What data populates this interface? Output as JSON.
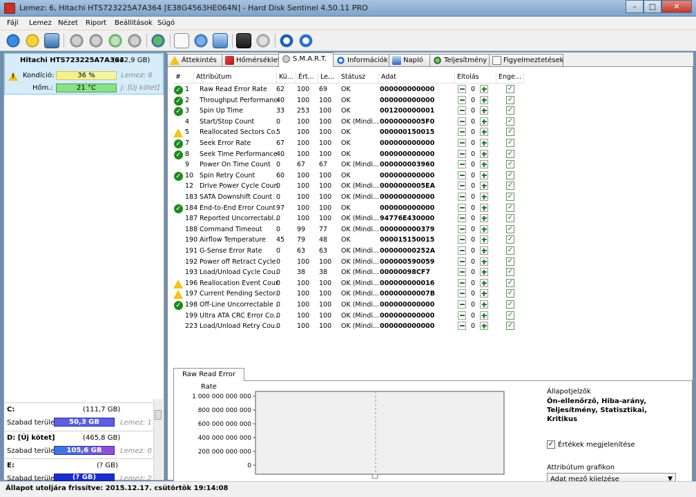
{
  "window": {
    "title": "Lemez: 6, Hitachi HTS723225A7A364 [E38G4563HE064N]  -  Hard Disk Sentinel 4.50.11 PRO",
    "min": "–",
    "max": "□",
    "close": "✕"
  },
  "menu": [
    "Fájl",
    "Lemez",
    "Nézet",
    "Riport",
    "Beállítások",
    "Súgó"
  ],
  "toolbar": [
    "refresh-icon",
    "alert-icon",
    "disk-icon",
    "fan-icon",
    "fan-icon",
    "fan-icon",
    "fan-icon",
    "globe-icon",
    "document-icon",
    "swap-icon",
    "network-icon",
    "test-icon",
    "speaker-icon",
    "help-icon",
    "info-icon"
  ],
  "left": {
    "disk_name": "Hitachi HTS723225A7A364",
    "disk_size": "(232,9 GB)",
    "cond_label": "Kondíció:",
    "cond_value": "36 %",
    "cond_pct": 36,
    "cond_disk": "Lemez: 6",
    "temp_label": "Hőm.:",
    "temp_value": "21 °C",
    "temp_pct": 100,
    "temp_vol": "J: [Új kötet]",
    "drives": [
      {
        "name": "C:",
        "size": "(111,7 GB)",
        "free_label": "Szabad terület",
        "free": "50,3 GB",
        "free_pct": 100,
        "disk": "Lemez: 1",
        "color": "#5d5fe2"
      },
      {
        "name": "D: [Új kötet]",
        "size": "(465,8 GB)",
        "free_label": "Szabad terület",
        "free": "105,6 GB",
        "free_pct": 100,
        "disk": "Lemez: 0",
        "color": "#2f7be0"
      },
      {
        "name": "E:",
        "size": "(? GB)",
        "free_label": "Szabad terület",
        "free": "(? GB)",
        "free_pct": 100,
        "disk": "Lemez: 2",
        "color": "#1a2bd0"
      }
    ]
  },
  "tabs": [
    {
      "label": "Áttekintés",
      "icon": "warning-icon"
    },
    {
      "label": "Hőmérséklet",
      "icon": "thermometer-icon"
    },
    {
      "label": "S.M.A.R.T.",
      "icon": "smart-icon"
    },
    {
      "label": "Információk",
      "icon": "info-icon"
    },
    {
      "label": "Napló",
      "icon": "log-icon"
    },
    {
      "label": "Teljesítmény",
      "icon": "performance-icon"
    },
    {
      "label": "Figyelmeztetések",
      "icon": "alerts-icon"
    }
  ],
  "smart": {
    "headers": [
      "#",
      "Attribútum",
      "Kü...",
      "Ért...",
      "Le...",
      "Státusz",
      "Adat",
      "Eltolás",
      "Enge..."
    ],
    "rows": [
      {
        "st": "ok",
        "id": "1",
        "name": "Raw Read Error Rate",
        "th": "62",
        "val": "100",
        "worst": "69",
        "status": "OK",
        "data": "000000000000",
        "off": "0"
      },
      {
        "st": "ok",
        "id": "2",
        "name": "Throughput Performance",
        "th": "40",
        "val": "100",
        "worst": "100",
        "status": "OK",
        "data": "000000000000",
        "off": "0"
      },
      {
        "st": "ok",
        "id": "3",
        "name": "Spin Up Time",
        "th": "33",
        "val": "253",
        "worst": "100",
        "status": "OK",
        "data": "001200000001",
        "off": "0"
      },
      {
        "st": "",
        "id": "4",
        "name": "Start/Stop Count",
        "th": "0",
        "val": "100",
        "worst": "100",
        "status": "OK (Mindi...",
        "data": "0000000005F0",
        "off": "0"
      },
      {
        "st": "warn",
        "id": "5",
        "name": "Reallocated Sectors Co...",
        "th": "5",
        "val": "100",
        "worst": "100",
        "status": "OK",
        "data": "000000150015",
        "off": "0"
      },
      {
        "st": "ok",
        "id": "7",
        "name": "Seek Error Rate",
        "th": "67",
        "val": "100",
        "worst": "100",
        "status": "OK",
        "data": "000000000000",
        "off": "0"
      },
      {
        "st": "ok",
        "id": "8",
        "name": "Seek Time Performance",
        "th": "40",
        "val": "100",
        "worst": "100",
        "status": "OK",
        "data": "000000000000",
        "off": "0"
      },
      {
        "st": "",
        "id": "9",
        "name": "Power On Time Count",
        "th": "0",
        "val": "67",
        "worst": "67",
        "status": "OK (Mindi...",
        "data": "000000003960",
        "off": "0"
      },
      {
        "st": "ok",
        "id": "10",
        "name": "Spin Retry Count",
        "th": "60",
        "val": "100",
        "worst": "100",
        "status": "OK",
        "data": "000000000000",
        "off": "0"
      },
      {
        "st": "",
        "id": "12",
        "name": "Drive Power Cycle Count",
        "th": "0",
        "val": "100",
        "worst": "100",
        "status": "OK (Mindi...",
        "data": "0000000005EA",
        "off": "0"
      },
      {
        "st": "",
        "id": "183",
        "name": "SATA Downshift Count",
        "th": "0",
        "val": "100",
        "worst": "100",
        "status": "OK (Mindi...",
        "data": "000000000000",
        "off": "0"
      },
      {
        "st": "ok",
        "id": "184",
        "name": "End-to-End Error Count",
        "th": "97",
        "val": "100",
        "worst": "100",
        "status": "OK",
        "data": "000000000000",
        "off": "0"
      },
      {
        "st": "",
        "id": "187",
        "name": "Reported Uncorrectabl...",
        "th": "0",
        "val": "100",
        "worst": "100",
        "status": "OK (Mindi...",
        "data": "94776E430000",
        "off": "0"
      },
      {
        "st": "",
        "id": "188",
        "name": "Command Timeout",
        "th": "0",
        "val": "99",
        "worst": "77",
        "status": "OK (Mindi...",
        "data": "000000000379",
        "off": "0"
      },
      {
        "st": "",
        "id": "190",
        "name": "Airflow Temperature",
        "th": "45",
        "val": "79",
        "worst": "48",
        "status": "OK",
        "data": "000015150015",
        "off": "0"
      },
      {
        "st": "",
        "id": "191",
        "name": "G-Sense Error Rate",
        "th": "0",
        "val": "63",
        "worst": "63",
        "status": "OK (Mindi...",
        "data": "00000000252A",
        "off": "0"
      },
      {
        "st": "",
        "id": "192",
        "name": "Power off Retract Cycle ...",
        "th": "0",
        "val": "100",
        "worst": "100",
        "status": "OK (Mindi...",
        "data": "000000590059",
        "off": "0"
      },
      {
        "st": "",
        "id": "193",
        "name": "Load/Unload Cycle Cou...",
        "th": "0",
        "val": "38",
        "worst": "38",
        "status": "OK (Mindi...",
        "data": "00000098CF7",
        "off": "0"
      },
      {
        "st": "warn",
        "id": "196",
        "name": "Reallocation Event Count",
        "th": "0",
        "val": "100",
        "worst": "100",
        "status": "OK (Mindi...",
        "data": "000000000016",
        "off": "0"
      },
      {
        "st": "warn",
        "id": "197",
        "name": "Current Pending Sector...",
        "th": "0",
        "val": "100",
        "worst": "100",
        "status": "OK (Mindi...",
        "data": "00000000007B",
        "off": "0"
      },
      {
        "st": "ok",
        "id": "198",
        "name": "Off-Line Uncorrectable ...",
        "th": "0",
        "val": "100",
        "worst": "100",
        "status": "OK (Mindi...",
        "data": "000000000000",
        "off": "0"
      },
      {
        "st": "",
        "id": "199",
        "name": "Ultra ATA CRC Error Co...",
        "th": "0",
        "val": "100",
        "worst": "100",
        "status": "OK (Mindi...",
        "data": "000000000000",
        "off": "0"
      },
      {
        "st": "",
        "id": "223",
        "name": "Load/Unload Retry Cou...",
        "th": "0",
        "val": "100",
        "worst": "100",
        "status": "OK (Mindi...",
        "data": "000000000000",
        "off": "0"
      }
    ]
  },
  "graph": {
    "tab_label": "Raw Read Error Rate",
    "yticks": [
      "1 000 000 000 000",
      "800 000 000 000",
      "600 000 000 000",
      "400 000 000 000",
      "200 000 000 000",
      "0"
    ],
    "legend_title": "Állapotjelzők",
    "legend_body": "Ön-ellenőrző, Hiba-arány, Teljesítmény, Statisztikai, Kritikus",
    "show_values_label": "Értékek megjelenítése",
    "attr_graph_label": "Attribútum grafikon",
    "attr_graph_value": "Adat mező kijelzése"
  },
  "status": "Állapot utoljára frissítve: 2015.12.17. csütörtök 19:14:08"
}
